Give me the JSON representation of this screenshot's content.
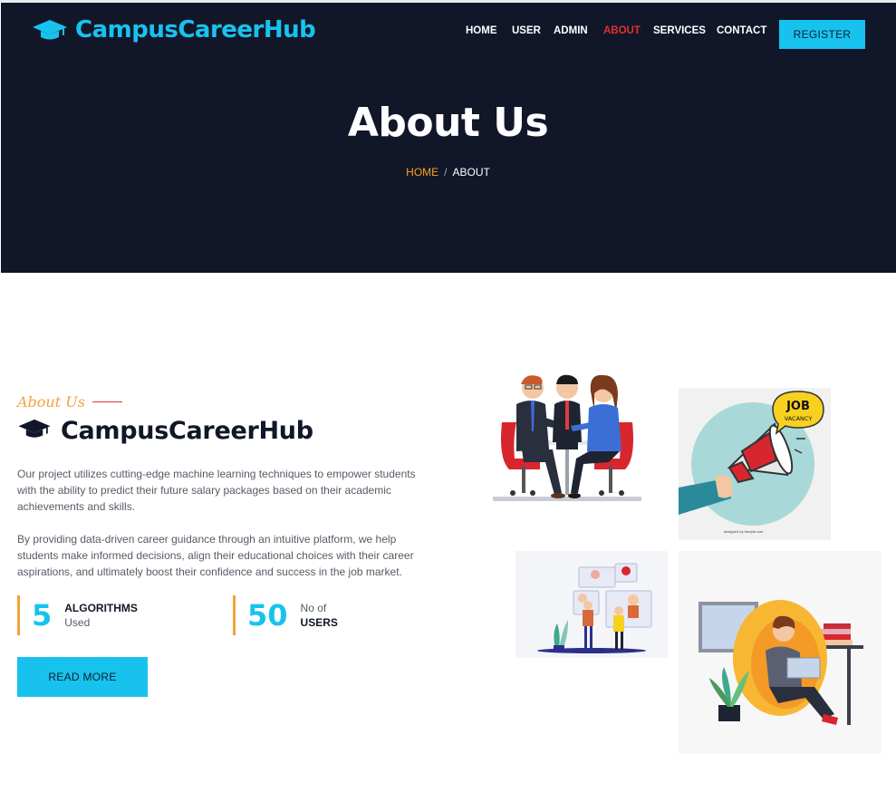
{
  "brand": {
    "name": "CampusCareerHub",
    "icon": "graduation-cap-icon",
    "color": "#17c3ee"
  },
  "nav": {
    "items": [
      {
        "label": "HOME"
      },
      {
        "label": "USER"
      },
      {
        "label": "ADMIN"
      },
      {
        "label": "ABOUT",
        "active": true
      },
      {
        "label": "SERVICES"
      },
      {
        "label": "CONTACT"
      }
    ],
    "register": "REGISTER"
  },
  "hero": {
    "title": "About Us",
    "breadcrumb": {
      "home": "HOME",
      "sep": "/",
      "current": "ABOUT"
    }
  },
  "about": {
    "tag": "About Us",
    "title": "CampusCareerHub",
    "paragraph1": "Our project utilizes cutting-edge machine learning techniques to empower students with the ability to predict their future salary packages based on their academic achievements and skills.",
    "paragraph2": "By providing data-driven career guidance through an intuitive platform, we help students make informed decisions, align their educational choices with their career aspirations, and ultimately boost their confidence and success in the job market.",
    "stats": [
      {
        "number": "5",
        "line1": "ALGORITHMS",
        "line2": "Used"
      },
      {
        "number": "50",
        "line1": "No of",
        "line2": "USERS"
      }
    ],
    "read_more": "READ MORE"
  },
  "images": {
    "job_vacancy": {
      "line1": "JOB",
      "line2": "VACANCY",
      "credit": "designed by freepik.com"
    }
  },
  "colors": {
    "hero_bg": "#111729",
    "accent": "#17c3ee",
    "active_nav": "#e0322c",
    "orange": "#f2a23a"
  }
}
